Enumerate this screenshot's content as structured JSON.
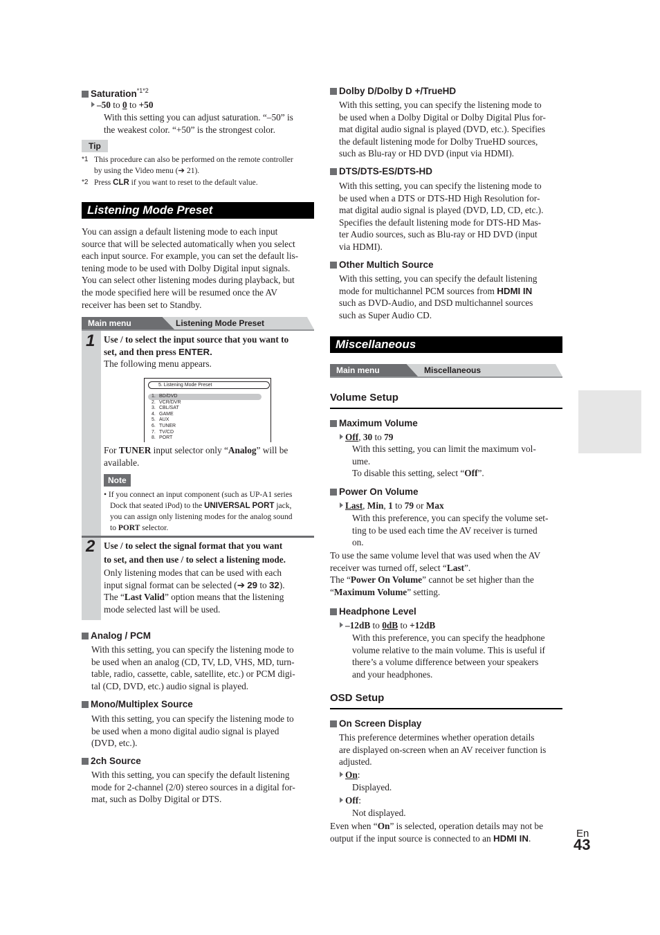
{
  "saturation": {
    "heading": "Saturation",
    "heading_sup": "*1*2",
    "range": {
      "min": "–50",
      "default": "0",
      "max": "+50",
      "sep": "to"
    },
    "desc_lines": [
      "With this setting you can adjust saturation. “–50” is",
      "the weakest color. “+50” is the strongest color."
    ],
    "tip_label": "Tip",
    "footnotes": [
      {
        "mark": "*1",
        "lines": [
          "This procedure can also be performed on the remote controller",
          "by using the Video menu (➔ 21)."
        ]
      },
      {
        "mark": "*2",
        "text_before": "Press ",
        "bold": "CLR",
        "text_after": " if you want to reset to the default value."
      }
    ]
  },
  "listening_mode_preset": {
    "title": "Listening Mode Preset",
    "intro_lines": [
      "You can assign a default listening mode to each input",
      "source that will be selected automatically when you select",
      "each input source. For example, you can set the default lis-",
      "tening mode to be used with Dolby Digital input signals.",
      "You can select other listening modes during playback, but",
      "the mode specified here will be resumed once the AV",
      "receiver has been set to Standby."
    ],
    "breadcrumb": {
      "main": "Main menu",
      "sub": "Listening Mode Preset"
    },
    "step1": {
      "number": "1",
      "bold_lines": [
        "Use    /    to select the input source that you want to",
        "set, and then press "
      ],
      "enter": "ENTER.",
      "after": "The following menu appears.",
      "osd": {
        "title": "5.   Listening Mode Preset",
        "items": [
          {
            "n": "1.",
            "label": "BD/DVD"
          },
          {
            "n": "2.",
            "label": "VCR/DVR"
          },
          {
            "n": "3.",
            "label": "CBL/SAT"
          },
          {
            "n": "4.",
            "label": "GAME"
          },
          {
            "n": "5.",
            "label": "AUX"
          },
          {
            "n": "6.",
            "label": "TUNER"
          },
          {
            "n": "7.",
            "label": "TV/CD"
          },
          {
            "n": "8.",
            "label": "PORT"
          }
        ]
      },
      "tuner_note": {
        "pre": "For ",
        "b1": "TUNER",
        "mid": " input selector only “",
        "b2": "Analog",
        "post": "” will be",
        "line2": "available."
      },
      "note_label": "Note",
      "note_lines": [
        "• If you connect an input component (such as UP-A1 series",
        "Dock that seated iPod) to the ",
        "UNIVERSAL PORT",
        " jack,",
        "you can assign only listening modes for the analog sound",
        "to ",
        "PORT",
        " selector."
      ]
    },
    "step2": {
      "number": "2",
      "bold_lines": [
        "Use    /    to select the signal format that you want",
        "to set, and then use    /    to select a listening mode."
      ],
      "lines": [
        "Only listening modes that can be used with each",
        "input signal format can be selected (➔ ",
        "29",
        " to ",
        "32",
        ").",
        "The “",
        "Last Valid",
        "” option means that the listening",
        "mode selected last will be used."
      ]
    },
    "sections": [
      {
        "heading": "Analog / PCM",
        "lines": [
          "With this setting, you can specify the listening mode to",
          "be used when an analog (CD, TV, LD, VHS, MD, turn-",
          "table, radio, cassette, cable, satellite, etc.) or PCM digi-",
          "tal (CD, DVD, etc.) audio signal is played."
        ]
      },
      {
        "heading": "Mono/Multiplex Source",
        "lines": [
          "With this setting, you can specify the listening mode to",
          "be used when a mono digital audio signal is played",
          "(DVD, etc.)."
        ]
      },
      {
        "heading": "2ch Source",
        "lines": [
          "With this setting, you can specify the default listening",
          "mode for 2-channel (2/0) stereo sources in a digital for-",
          "mat, such as Dolby Digital or DTS."
        ]
      },
      {
        "heading": "Dolby D/Dolby D +/TrueHD",
        "lines": [
          "With this setting, you can specify the listening mode to",
          "be used when a Dolby Digital or Dolby Digital Plus for-",
          "mat digital audio signal is played (DVD, etc.). Specifies",
          "the default listening mode for Dolby TrueHD sources,",
          "such as Blu-ray or HD DVD (input via HDMI)."
        ]
      },
      {
        "heading": "DTS/DTS-ES/DTS-HD",
        "lines": [
          "With this setting, you can specify the listening mode to",
          "be used when a DTS or DTS-HD High Resolution for-",
          "mat digital audio signal is played (DVD, LD, CD, etc.).",
          "Specifies the default listening mode for DTS-HD Mas-",
          "ter Audio sources, such as Blu-ray or HD DVD (input",
          "via HDMI)."
        ]
      },
      {
        "heading": "Other Multich Source",
        "lines": [
          "With this setting, you can specify the default listening",
          "mode for multichannel PCM sources from ",
          "HDMI IN",
          "such as DVD-Audio, and DSD multichannel sources",
          "such as Super Audio CD."
        ]
      }
    ]
  },
  "miscellaneous": {
    "title": "Miscellaneous",
    "breadcrumb": {
      "main": "Main menu",
      "sub": "Miscellaneous"
    },
    "volume_setup": {
      "heading": "Volume Setup",
      "maximum_volume": {
        "heading": "Maximum Volume",
        "options": {
          "a": "Off",
          "b": "30",
          "sep": "to",
          "c": "79"
        },
        "lines": [
          "With this setting, you can limit the maximum vol-",
          "ume.",
          "To disable this setting, select “",
          "Off",
          "”."
        ]
      },
      "power_on_volume": {
        "heading": "Power On Volume",
        "options": {
          "a": "Last",
          "b": "Min",
          "c": "1",
          "sep": "to",
          "d": "79",
          "or": "or",
          "e": "Max"
        },
        "lines": [
          "With this preference, you can specify the volume set-",
          "ting to be used each time the AV receiver is turned",
          "on."
        ],
        "after": [
          "To use the same volume level that was used when the AV",
          "receiver was turned off, select “",
          "Last",
          "”.",
          "The “",
          "Power On Volume",
          "” cannot be set higher than the",
          "“",
          "Maximum Volume",
          "” setting."
        ]
      },
      "headphone_level": {
        "heading": "Headphone Level",
        "options": {
          "min": "–12dB",
          "default": "0dB",
          "max": "+12dB",
          "sep": "to"
        },
        "lines": [
          "With this preference, you can specify the headphone",
          "volume relative to the main volume. This is useful if",
          "there’s a volume difference between your speakers",
          "and your headphones."
        ]
      }
    },
    "osd_setup": {
      "heading": "OSD Setup",
      "on_screen_display": {
        "heading": "On Screen Display",
        "lines": [
          "This preference determines whether operation details",
          "are displayed on-screen when an AV receiver function is",
          "adjusted."
        ],
        "options": [
          {
            "label": "On",
            "desc": "Displayed.",
            "default": true
          },
          {
            "label": "Off",
            "desc": "Not displayed.",
            "default": false
          }
        ],
        "after": [
          "Even when “",
          "On",
          "” is selected, operation details may not be",
          "output if the input source is connected to an ",
          "HDMI IN",
          "."
        ]
      }
    }
  },
  "page": {
    "lang": "En",
    "number": "43"
  },
  "colors": {
    "bar_bg": "#000000",
    "crumb_main": "#6d6e71",
    "crumb_bg": "#d1d3d4",
    "tab": "#e6e6e6"
  }
}
